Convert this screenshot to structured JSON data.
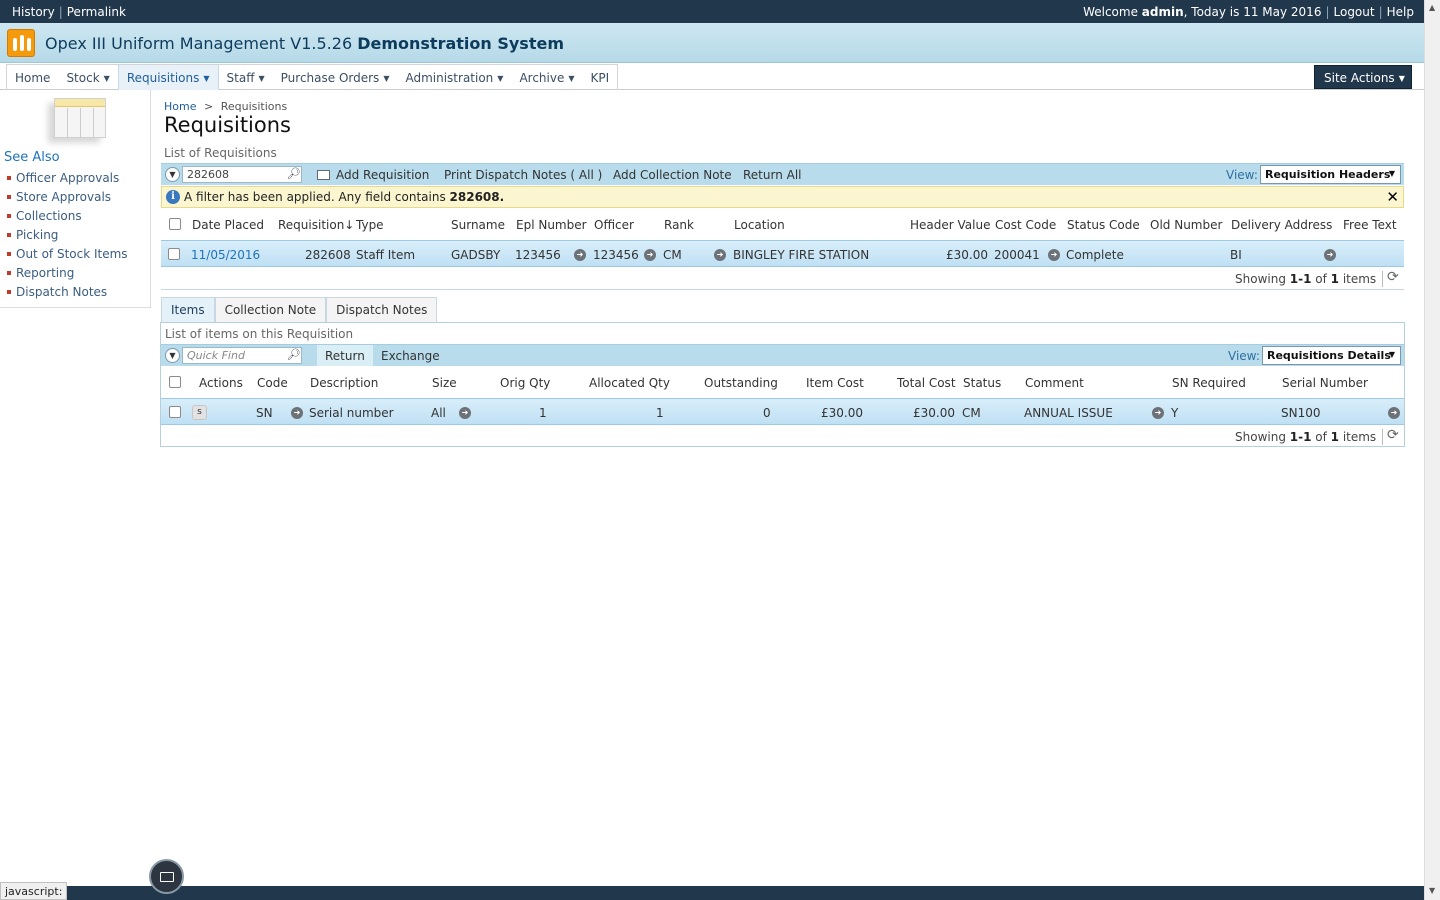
{
  "topbar": {
    "history": "History",
    "permalink": "Permalink",
    "welcome_prefix": "Welcome ",
    "user": "admin",
    "date_text": ", Today is 11 May 2016",
    "logout": "Logout",
    "help": "Help"
  },
  "site": {
    "title": "Opex III Uniform Management V1.5.26 ",
    "subtitle": "Demonstration System"
  },
  "nav": {
    "items": [
      {
        "label": "Home"
      },
      {
        "label": "Stock"
      },
      {
        "label": "Requisitions"
      },
      {
        "label": "Staff"
      },
      {
        "label": "Purchase Orders"
      },
      {
        "label": "Administration"
      },
      {
        "label": "Archive"
      },
      {
        "label": "KPI"
      }
    ],
    "site_actions": "Site Actions"
  },
  "leftnav": {
    "heading": "See Also",
    "links": [
      "Officer Approvals",
      "Store Approvals",
      "Collections",
      "Picking",
      "Out of Stock Items",
      "Reporting",
      "Dispatch Notes"
    ]
  },
  "breadcrumb": {
    "home": "Home",
    "sep": ">",
    "current": "Requisitions"
  },
  "page_title": "Requisitions",
  "req_list": {
    "label": "List of Requisitions",
    "search_value": "282608",
    "actions": [
      "Add Requisition",
      "Print Dispatch Notes ( All )",
      "Add Collection Note",
      "Return All"
    ],
    "view_label": "View:",
    "view_value": "Requisition Headers",
    "filter_text": "A filter has been applied. Any field contains ",
    "filter_value": "282608.",
    "columns": [
      "Date Placed",
      "Requisition↓",
      "Type",
      "Surname",
      "Epl Number",
      "Officer",
      "Rank",
      "Location",
      "Header Value",
      "Cost Code",
      "Status Code",
      "Old Number",
      "Delivery Address",
      "Free Text"
    ],
    "row": {
      "date_placed": "11/05/2016",
      "requisition": "282608",
      "type": "Staff Item",
      "surname": "GADSBY",
      "epl_number": "123456",
      "officer": "123456",
      "rank": "CM",
      "location": "BINGLEY FIRE STATION",
      "header_value": "£30.00",
      "cost_code": "200041",
      "status_code": "Complete",
      "old_number": "",
      "delivery_address": "BI",
      "free_text": ""
    },
    "footer": {
      "showing": "Showing ",
      "range": "1-1",
      "of": " of ",
      "total": "1",
      "items": " items"
    }
  },
  "tabs": [
    "Items",
    "Collection Note",
    "Dispatch Notes"
  ],
  "items_list": {
    "label": "List of items on this Requisition",
    "search_placeholder": "Quick Find",
    "actions": [
      "Return",
      "Exchange"
    ],
    "view_label": "View:",
    "view_value": "Requisitions Details",
    "columns": [
      "Actions",
      "Code",
      "Description",
      "Size",
      "Orig Qty",
      "Allocated Qty",
      "Outstanding",
      "Item Cost",
      "Total Cost",
      "Status",
      "Comment",
      "SN Required",
      "Serial Number"
    ],
    "row": {
      "action_icon": "s",
      "code": "SN",
      "description": "Serial number",
      "size": "All",
      "orig_qty": "1",
      "allocated_qty": "1",
      "outstanding": "0",
      "item_cost": "£30.00",
      "total_cost": "£30.00",
      "status": "CM",
      "comment": "ANNUAL ISSUE",
      "sn_required": "Y",
      "serial_number": "SN100"
    },
    "footer": {
      "showing": "Showing ",
      "range": "1-1",
      "of": " of ",
      "total": "1",
      "items": " items"
    }
  },
  "statusbar": {
    "text": "javascript:"
  },
  "icons": {
    "mail": "envelope-icon",
    "refresh": "refresh-icon",
    "search": "magnifier-icon",
    "info": "info-icon",
    "close": "close-icon"
  },
  "colors": {
    "topbar": "#21374c",
    "titlebar": "#b6d9e8",
    "toolbar": "#b8dceb",
    "row_highlight": "#bfe0f4",
    "filter_bg": "#fbf6d0",
    "logo": "#f59a0c"
  }
}
